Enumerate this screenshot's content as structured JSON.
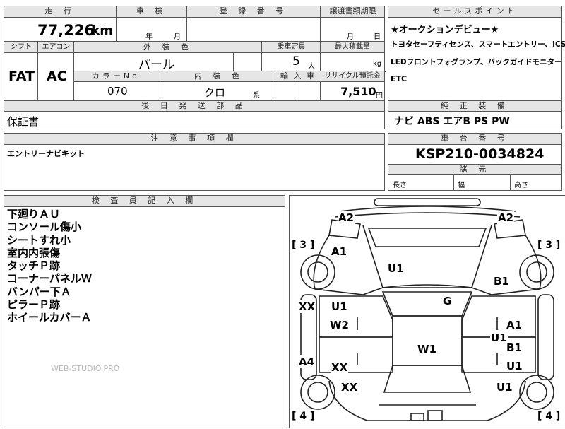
{
  "header": {
    "mileage_label": "走 行",
    "inspection_label": "車 検",
    "registration_label": "登 録 番 号",
    "transfer_label": "譲渡書類期限",
    "mileage_value": "77,226",
    "mileage_unit": "km",
    "year_unit": "年",
    "month_unit": "月",
    "transfer_month": "月",
    "transfer_day": "日"
  },
  "row2": {
    "shift_label": "シフト",
    "aircon_label": "エアコン",
    "exterior_label": "外 装 色",
    "capacity_label": "乗車定員",
    "maxload_label": "最大積載量",
    "shift_value": "FAT",
    "aircon_value": "AC",
    "exterior_value": "パール",
    "capacity_value": "5",
    "capacity_unit": "人",
    "maxload_unit": "kg",
    "colorno_label": "カラーNo.",
    "interior_label": "内 装 色",
    "import_label": "輸 入 車",
    "recycle_label": "リサイクル預託金",
    "colorno_value": "070",
    "interior_value": "クロ",
    "interior_unit": "系",
    "recycle_value": "7,510",
    "recycle_unit": "円"
  },
  "later_parts": {
    "label": "後 日 発 送 部 品",
    "value": "保証書"
  },
  "sales_points": {
    "label": "セールスポイント",
    "lines": [
      "★オークションデビュー★",
      "トヨタセーフティセンス、スマートエントリー、ICS",
      "LEDフロントフォグランプ、バックガイドモニター",
      "ETC"
    ]
  },
  "standard_equipment": {
    "label": "純 正 装 備",
    "value": "ナビ ABS エアB PS PW"
  },
  "notes": {
    "label": "注 意 事 項 欄",
    "value": "エントリーナビキット"
  },
  "chassis": {
    "label": "車 台 番 号",
    "value": "KSP210-0034824",
    "dims_label": "諸 元",
    "length_label": "長さ",
    "width_label": "幅",
    "height_label": "高さ"
  },
  "inspector": {
    "label": "検 査 員 記 入 欄",
    "lines": [
      "下廻りＡＵ",
      "コンソール傷小",
      "シートすれ小",
      "室内内張傷",
      "タッチＰ跡",
      "コーナーパネルＷ",
      "バンパー下Ａ",
      "ピラーＰ跡",
      "ホイールカバーＡ"
    ]
  },
  "watermark": "WEB-STUDIO.PRO",
  "diagram": {
    "marks": [
      {
        "id": "a2-left",
        "text": "A2"
      },
      {
        "id": "a2-right",
        "text": "A2"
      },
      {
        "id": "bracket3-left",
        "text": "[ 3 ]"
      },
      {
        "id": "bracket3-right",
        "text": "[ 3 ]"
      },
      {
        "id": "a1-front",
        "text": "A1"
      },
      {
        "id": "u1-hood",
        "text": "U1"
      },
      {
        "id": "b1-right",
        "text": "B1"
      },
      {
        "id": "xx-left",
        "text": "XX"
      },
      {
        "id": "u1-left",
        "text": "U1"
      },
      {
        "id": "g-roof",
        "text": "G"
      },
      {
        "id": "w2-left",
        "text": "W2"
      },
      {
        "id": "a1-right",
        "text": "A1"
      },
      {
        "id": "u1-right",
        "text": "U1"
      },
      {
        "id": "w1-center",
        "text": "W1"
      },
      {
        "id": "b1-rdoor",
        "text": "B1"
      },
      {
        "id": "a4-left",
        "text": "A4"
      },
      {
        "id": "xx-rdoor-left",
        "text": "XX"
      },
      {
        "id": "u1-rdoor-right",
        "text": "U1"
      },
      {
        "id": "xx-rear",
        "text": "XX"
      },
      {
        "id": "u1-rear-right",
        "text": "U1"
      },
      {
        "id": "bracket4-left",
        "text": "[ 4 ]"
      },
      {
        "id": "bracket4-right",
        "text": "[ 4 ]"
      }
    ]
  }
}
